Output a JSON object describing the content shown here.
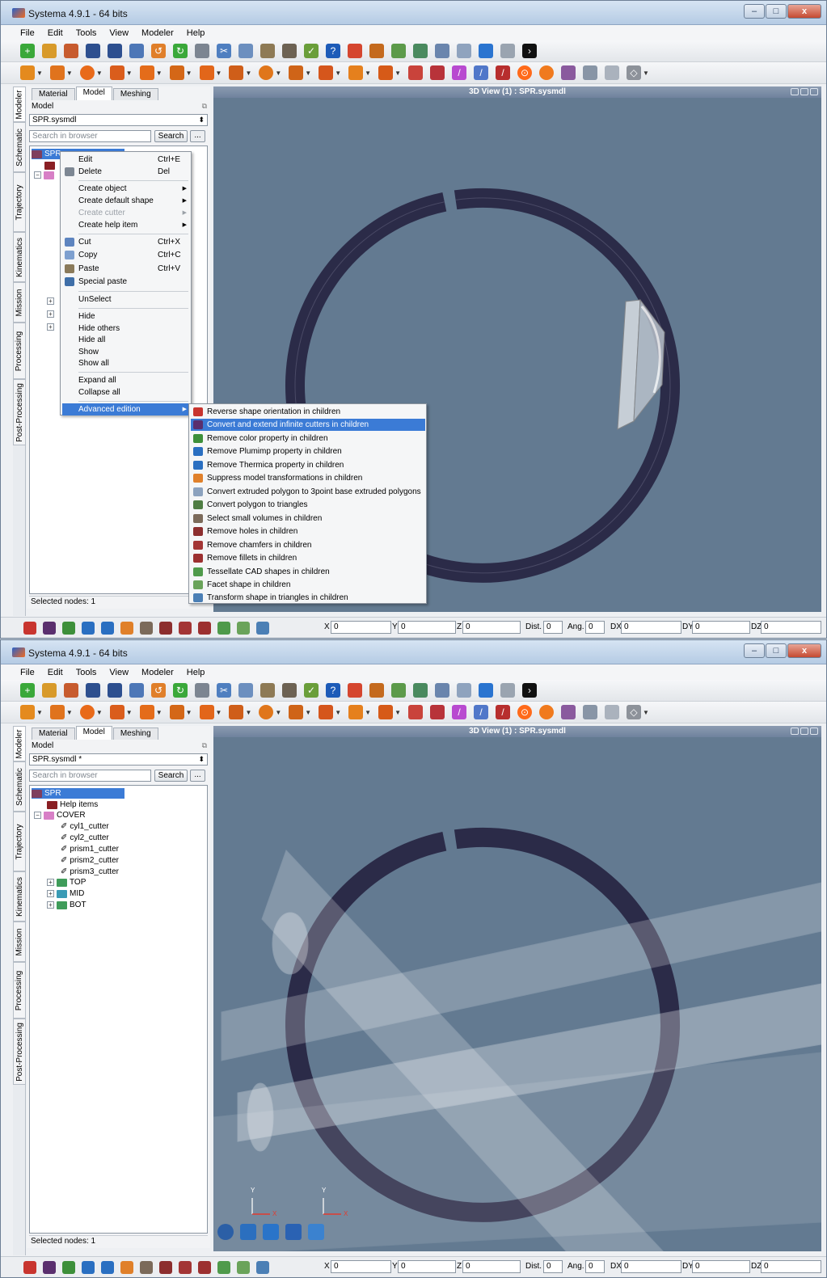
{
  "window": {
    "title": "Systema 4.9.1 - 64 bits",
    "min": "–",
    "max": "□",
    "close": "x"
  },
  "menu": [
    "File",
    "Edit",
    "Tools",
    "View",
    "Modeler",
    "Help"
  ],
  "side_tabs": [
    "Modeler",
    "Schematic",
    "Trajectory",
    "Kinematics",
    "Mission",
    "Processing",
    "Post-Processing"
  ],
  "panel_tabs": [
    "Material",
    "Model",
    "Meshing"
  ],
  "panel_label": "Model",
  "s1": {
    "model_file": "SPR.sysmdl",
    "search_placeholder": "Search in browser",
    "search_label": "Search",
    "more_label": "...",
    "root_node": "SPR",
    "status": "Selected nodes: 1",
    "view_title": "3D View (1) : SPR.sysmdl"
  },
  "s2": {
    "model_file": "SPR.sysmdl *",
    "search_placeholder": "Search in browser",
    "search_label": "Search",
    "more_label": "...",
    "tree": [
      "SPR",
      "Help items",
      "COVER",
      "cyl1_cutter",
      "cyl2_cutter",
      "prism1_cutter",
      "prism2_cutter",
      "prism3_cutter",
      "TOP",
      "MID",
      "BOT"
    ],
    "status": "Selected nodes: 1",
    "view_title": "3D View (1) : SPR.sysmdl",
    "axis_y": "Y",
    "axis_x": "X"
  },
  "context_menu": {
    "edit": "Edit",
    "edit_sc": "Ctrl+E",
    "delete": "Delete",
    "delete_sc": "Del",
    "create_object": "Create object",
    "create_default_shape": "Create default shape",
    "create_cutter": "Create cutter",
    "create_help_item": "Create help item",
    "cut": "Cut",
    "cut_sc": "Ctrl+X",
    "copy": "Copy",
    "copy_sc": "Ctrl+C",
    "paste": "Paste",
    "paste_sc": "Ctrl+V",
    "special_paste": "Special paste",
    "unselect": "UnSelect",
    "hide": "Hide",
    "hide_others": "Hide others",
    "hide_all": "Hide all",
    "show": "Show",
    "show_all": "Show all",
    "expand_all": "Expand all",
    "collapse_all": "Collapse all",
    "advanced_edition": "Advanced edition"
  },
  "submenu": [
    "Reverse shape orientation in children",
    "Convert and extend infinite cutters in children",
    "Remove color property in children",
    "Remove Plumimp property in children",
    "Remove Thermica property in children",
    "Suppress model transformations in children",
    "Convert extruded polygon to 3point base extruded polygons",
    "Convert polygon to triangles",
    "Select small volumes in children",
    "Remove holes in children",
    "Remove chamfers in children",
    "Remove fillets in children",
    "Tessellate CAD shapes in children",
    "Facet shape in children",
    "Transform shape in triangles in children"
  ],
  "coords": {
    "x": "0",
    "y": "0",
    "z": "0",
    "dist": "0",
    "ang": "0",
    "dx": "0",
    "dy": "0",
    "dz": "0",
    "x_label": "X",
    "y_label": "Y",
    "z_label": "Z",
    "dist_label": "Dist.",
    "ang_label": "Ang.",
    "dx_label": "DX",
    "dy_label": "DY",
    "dz_label": "DZ"
  },
  "colors": {
    "accent": "#3b7bd6",
    "viewport": "#637a91",
    "ring": "#2b2b48"
  }
}
